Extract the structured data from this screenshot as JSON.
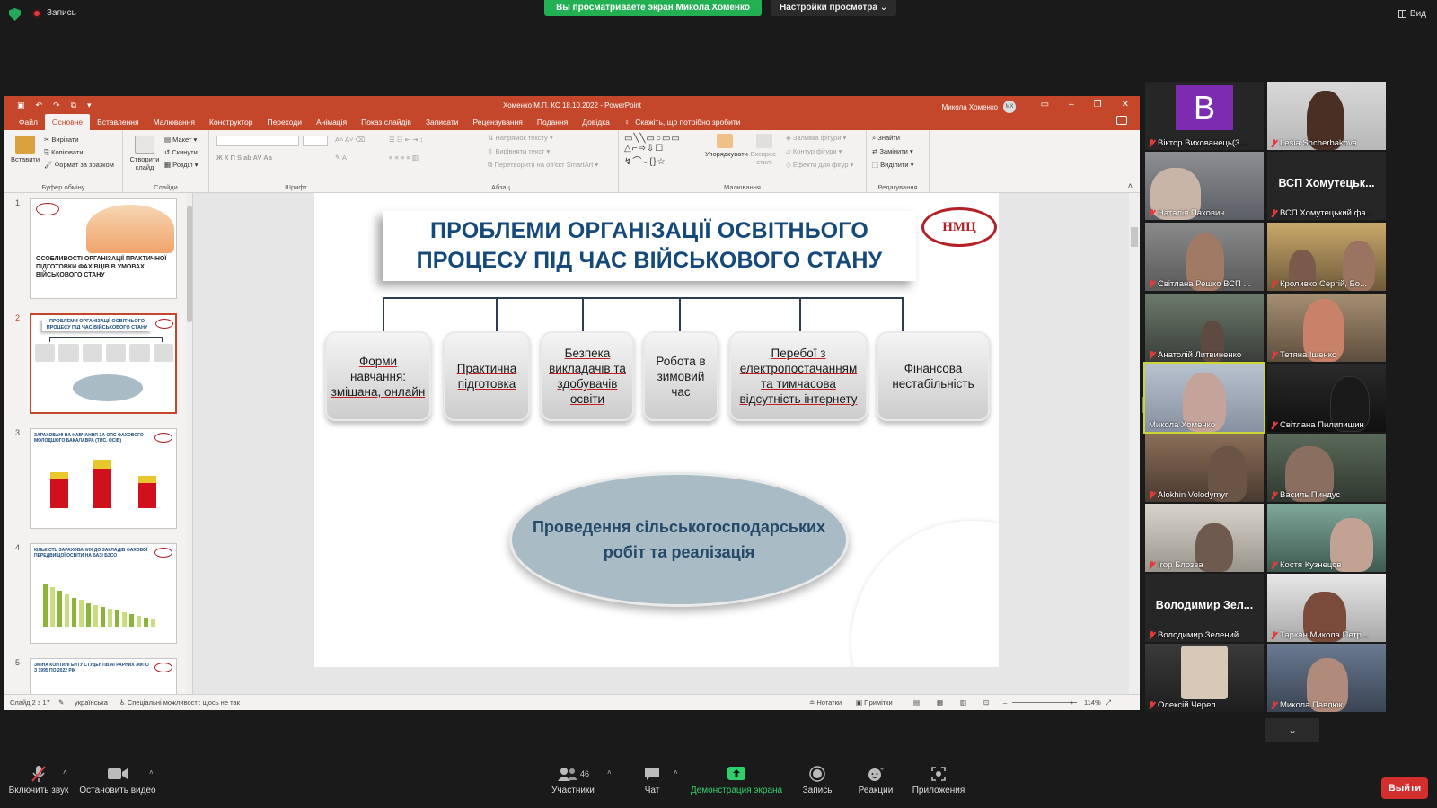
{
  "zoom": {
    "recording_label": "Запись",
    "viewing_banner": "Вы просматриваете экран Микола Хоменко",
    "view_settings": "Настройки просмотра ⌄",
    "view_button": "Вид",
    "participants_count": "46",
    "toolbar": {
      "audio": "Включить звук",
      "video": "Остановить видео",
      "participants": "Участники",
      "chat": "Чат",
      "share": "Демонстрация экрана",
      "record": "Запись",
      "reactions": "Реакции",
      "apps": "Приложения",
      "leave": "Выйти"
    },
    "colors": {
      "share_green": "#23b053",
      "leave_red": "#d32f2f",
      "active_tile": "#c8d636"
    }
  },
  "powerpoint": {
    "doc_title": "Хоменко М.П. КС 18.10.2022  -  PowerPoint",
    "user_name": "Микола Хоменко",
    "user_initials": "МХ",
    "tabs": [
      "Файл",
      "Основне",
      "Вставлення",
      "Малювання",
      "Конструктор",
      "Переходи",
      "Анімація",
      "Показ слайдів",
      "Записати",
      "Рецензування",
      "Подання",
      "Довідка"
    ],
    "active_tab": "Основне",
    "tell_me": "Скажіть, що потрібно зробити",
    "ribbon": {
      "clipboard": {
        "paste": "Вставити",
        "cut": "Вирізати",
        "copy": "Копіювати",
        "format": "Формат за зразком",
        "name": "Буфер обміну"
      },
      "slides": {
        "new": "Створити слайд",
        "layout": "Макет",
        "reset": "Скинути",
        "section": "Розділ",
        "name": "Слайди"
      },
      "font": {
        "name": "Шрифт"
      },
      "paragraph": {
        "text_dir": "Напрямок тексту",
        "align": "Вирівняти текст",
        "smartart": "Перетворити на об'єкт SmartArt",
        "name": "Абзац"
      },
      "drawing": {
        "arrange": "Упорядкувати",
        "quick": "Експрес-стилі",
        "fill": "Заливка фігури",
        "outline": "Контур фігури",
        "effects": "Ефекти для фігур",
        "name": "Малювання"
      },
      "editing": {
        "find": "Знайти",
        "replace": "Замінити",
        "select": "Виділити",
        "name": "Редагування"
      }
    },
    "slide_numbers": [
      "1",
      "2",
      "3",
      "4",
      "5"
    ],
    "thumbnails": {
      "t1_title": "ОСОБЛИВОСТІ ОРГАНІЗАЦІЇ ПРАКТИЧНОЇ ПІДГОТОВКИ ФАХІВЦІВ В УМОВАХ ВІЙСЬКОВОГО СТАНУ",
      "t2_title": "ПРОБЛЕМИ ОРГАНІЗАЦІЇ ОСВІТНЬОГО ПРОЦЕСУ ПІД ЧАС ВІЙСЬКОВОГО СТАНУ",
      "t3_title": "ЗАРАХОВАНІ НА НАВЧАННЯ ЗА ОПС ФАХОВОГО МОЛОДШОГО БАКАЛАВРА (ТИС. ОСІБ)",
      "t4_title": "КІЛЬКІСТЬ ЗАРАХОВАНИХ ДО ЗАКЛАДІВ ФАХОВОЇ ПЕРЕДВИЩОЇ ОСВІТИ НА БАЗІ БЗСО",
      "t5_title": "ЗМІНА КОНТИНГЕНТУ СТУДЕНТІВ АГРАРНИХ ЗФПО З 1995 ПО 2022 РІК"
    },
    "slide": {
      "title_line1": "ПРОБЛЕМИ ОРГАНІЗАЦІЇ ОСВІТНЬОГО",
      "title_line2": "ПРОЦЕСУ ПІД ЧАС ВІЙСЬКОВОГО СТАНУ",
      "logo": "НМЦ",
      "cards": [
        "Форми навчання: змішана, онлайн",
        "Практична підготовка",
        "Безпека викладачів та здобувачів освіти",
        "Робота в зимовий час",
        "Перебої з електропостачанням та тимчасова відсутність інтернету",
        "Фінансова нестабільність"
      ],
      "ellipse_text": "Проведення сільськогосподарських робіт та  реалізація",
      "colors": {
        "title": "#14497a",
        "ellipse": "#a9bcc6",
        "ellipse_text": "#24496a"
      }
    },
    "status": {
      "slide_pos": "Слайд 2 з 17",
      "language": "українська",
      "accessibility": "Спеціальні можливості: щось не так",
      "notes": "Нотатки",
      "comments": "Примітки",
      "zoom": "114%"
    }
  },
  "participants": [
    {
      "name": "Віктор Вихованець(3...",
      "type": "letter",
      "letter": "B"
    },
    {
      "name": "Lesia Shcherbakova",
      "type": "cam"
    },
    {
      "name": "Наталія Пахович",
      "type": "cam"
    },
    {
      "name": "ВСП Хомутецький фа...",
      "type": "text",
      "big": "ВСП  Хомутецьк..."
    },
    {
      "name": "Світлана Решко ВСП ...",
      "type": "cam"
    },
    {
      "name": "Кроливко Сергій, Бо...",
      "type": "cam"
    },
    {
      "name": "Анатолій Литвиненко",
      "type": "cam"
    },
    {
      "name": "Тетяна Іщенко",
      "type": "cam"
    },
    {
      "name": "Микола Хоменко",
      "type": "cam",
      "active": true
    },
    {
      "name": "Світлана Пилипишин",
      "type": "cam"
    },
    {
      "name": "Alokhin Volodymyr",
      "type": "cam"
    },
    {
      "name": "Василь Пиндус",
      "type": "cam"
    },
    {
      "name": "Ігор Блозва",
      "type": "cam"
    },
    {
      "name": "Костя Кузнецов",
      "type": "cam"
    },
    {
      "name": "Володимир Зелений",
      "type": "text",
      "big": "Володимир  Зел..."
    },
    {
      "name": "Таркан Микола Петр...",
      "type": "cam"
    },
    {
      "name": "Олексій Черел",
      "type": "cam"
    },
    {
      "name": "Микола Павлюк",
      "type": "cam"
    }
  ]
}
